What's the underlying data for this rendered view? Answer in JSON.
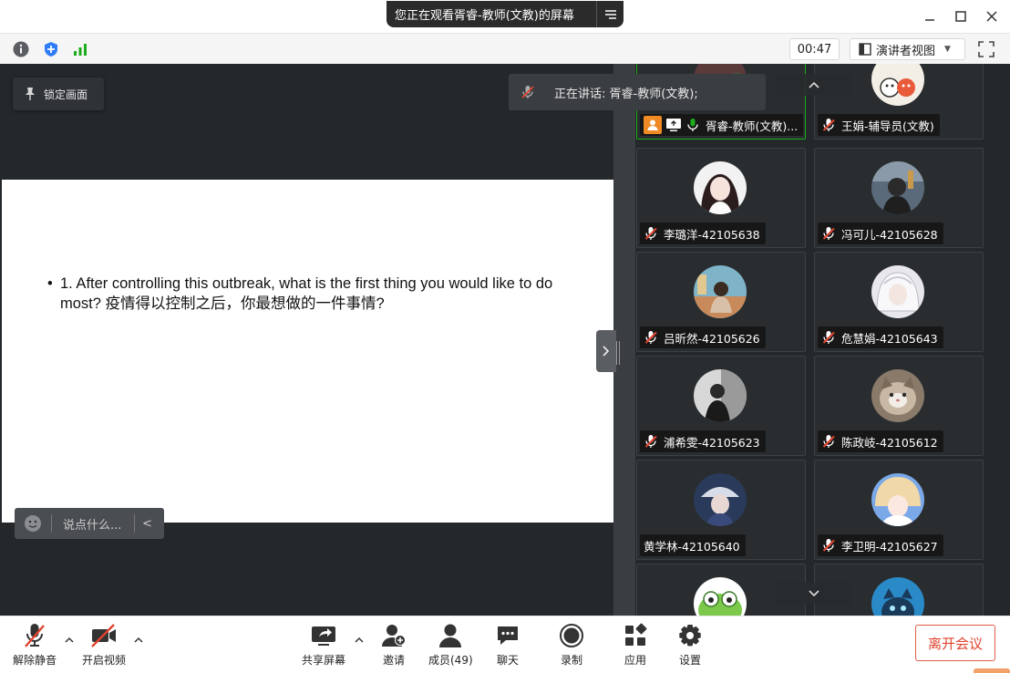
{
  "titlebar": {
    "share_banner": "您正在观看胥睿-教师(文教)的屏幕"
  },
  "statusbar": {
    "timer": "00:47",
    "view_mode": "演讲者视图"
  },
  "main": {
    "lock_label": "锁定画面",
    "speaking_text": "正在讲话: 胥睿-教师(文教);",
    "slide_bullet": "•",
    "slide_text": "1.  After controlling this outbreak, what is the first thing you would like to do most? 疫情得以控制之后，你最想做的一件事情?",
    "chat_placeholder": "说点什么..."
  },
  "gallery": {
    "tiles": [
      {
        "name": "胥睿-教师(文教)..."
      },
      {
        "name": "王娟-辅导员(文教)"
      },
      {
        "name": "李璐洋-42105638"
      },
      {
        "name": "冯可儿-42105628"
      },
      {
        "name": "吕昕然-42105626"
      },
      {
        "name": "危慧娟-42105643"
      },
      {
        "name": "浦希雯-42105623"
      },
      {
        "name": "陈政岐-42105612"
      },
      {
        "name": "黄学林-42105640"
      },
      {
        "name": "李卫明-42105627"
      }
    ]
  },
  "toolbar": {
    "unmute": "解除静音",
    "start_video": "开启视频",
    "share_screen": "共享屏幕",
    "invite": "邀请",
    "members": "成员(49)",
    "chat": "聊天",
    "record": "录制",
    "apps": "应用",
    "settings": "设置",
    "leave": "离开会议"
  },
  "colors": {
    "accent_green": "#1aad19",
    "leave_red": "#e0442f",
    "host_orange": "#f08a24",
    "muted_red": "#e0442f"
  }
}
